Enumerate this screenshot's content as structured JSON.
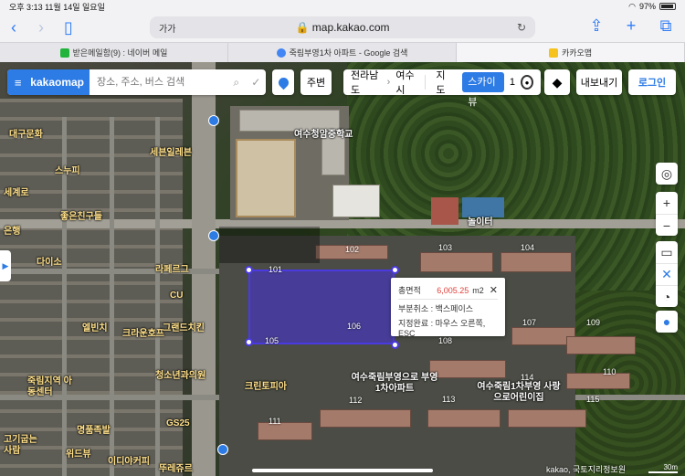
{
  "status_bar": {
    "time": "오후 3:13",
    "date": "11월 14일 일요일",
    "battery": "97%"
  },
  "browser": {
    "address_prefix": "가가",
    "url": "map.kakao.com",
    "tabs": [
      {
        "label": "받은메일함(9) : 네이버 메일",
        "favicon_color": "#22b33c"
      },
      {
        "label": "죽림부영1차 아파트 - Google 검색",
        "favicon_color": "#4285f4"
      },
      {
        "label": "카카오맵",
        "favicon_color": "#f6c21c"
      }
    ]
  },
  "map_ui": {
    "logo": "kakaomap",
    "search_placeholder": "장소, 주소, 버스 검색",
    "nearby_label": "주변",
    "region_province": "전라남도",
    "region_city": "여수시",
    "map_mode_label": "지도",
    "skyview_label": "스카이뷰",
    "skyview_count": "1",
    "export_label": "내보내기",
    "login_label": "로그인"
  },
  "area_popup": {
    "label_total": "총면적",
    "value": "6,005.25",
    "unit": "m2",
    "line1": "부분취소 : 백스페이스",
    "line2": "지정완료 : 마우스 오른쪽, ESC"
  },
  "map_labels": {
    "school": "여수청암중학교",
    "building_102": "102",
    "building_103": "103",
    "building_104": "104",
    "building_101": "101",
    "building_105": "105",
    "building_106": "106",
    "building_107": "107",
    "building_108": "108",
    "building_109": "109",
    "building_110": "110",
    "building_111": "111",
    "building_112": "112",
    "building_113": "113",
    "building_114": "114",
    "building_115": "115",
    "water_park": "놀이터",
    "apt_name": "여수죽림부영으로 부영1차아파트",
    "daycare": "여수죽림1차부영 사랑으로어린이집",
    "pharmacy": "크린토피아",
    "kids_clinic": "세븐일레븐",
    "snoopy": "스누피",
    "store_a": "라페르그",
    "store_b": "CU",
    "store_c": "크라운호프",
    "store_d": "그랜드치킨",
    "store_e": "청소년과의원",
    "store_f": "GS25",
    "store_g": "이디야커피",
    "store_h": "뚜레쥬르",
    "store_i": "엘빈치",
    "store_j": "명품족발",
    "store_k": "위드뷰",
    "store_l": "다이소",
    "store_m": "좋은친구들",
    "store_n": "은행",
    "store_o": "죽림지역 아동센터",
    "store_p": "고기굽는사람",
    "store_q": "세계로",
    "store_r": "대구문화"
  },
  "footer": {
    "copyright": "kakao, 국토지리정보원",
    "scale": "30m"
  }
}
